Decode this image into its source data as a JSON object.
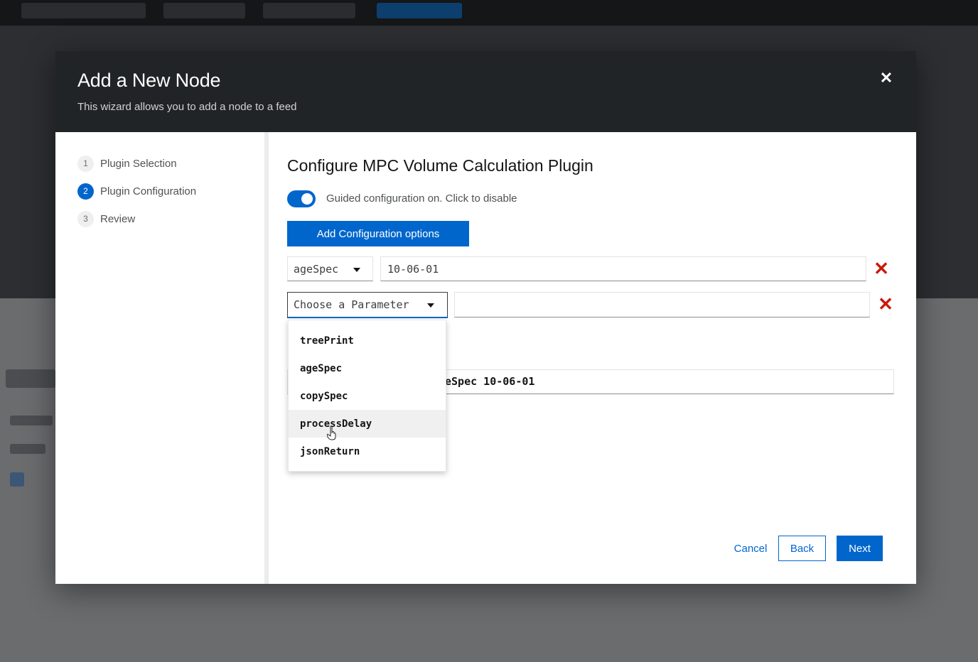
{
  "modal": {
    "title": "Add a New Node",
    "description": "This wizard allows you to add a node to a feed",
    "close_icon": "close-icon"
  },
  "steps": [
    {
      "number": "1",
      "label": "Plugin Selection",
      "current": false
    },
    {
      "number": "2",
      "label": "Plugin Configuration",
      "current": true
    },
    {
      "number": "3",
      "label": "Review",
      "current": false
    }
  ],
  "content": {
    "title": "Configure MPC Volume Calculation Plugin",
    "toggle_label": "Guided configuration on. Click to disable",
    "toggle_on": true,
    "add_button_label": "Add Configuration options"
  },
  "params": [
    {
      "selected": "ageSpec",
      "value": "10-06-01"
    },
    {
      "selected": "Choose a Parameter",
      "value": ""
    }
  ],
  "dropdown": {
    "options": [
      "treePrint",
      "ageSpec",
      "copySpec",
      "processDelay",
      "jsonReturn"
    ],
    "hovered": "processDelay"
  },
  "command_preview": "eSpec 10-06-01",
  "footer": {
    "cancel_label": "Cancel",
    "back_label": "Back",
    "next_label": "Next"
  },
  "colors": {
    "primary": "#0066cc",
    "danger": "#c9190b",
    "header_bg": "#212427"
  }
}
